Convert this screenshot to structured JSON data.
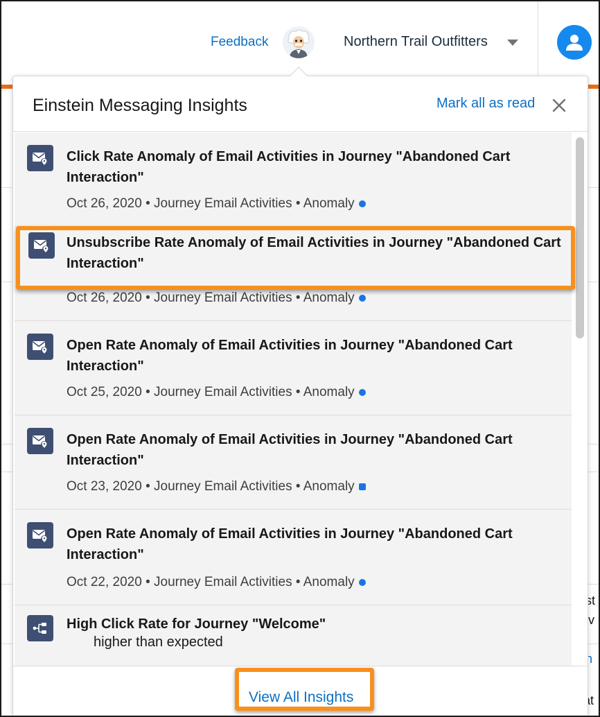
{
  "header": {
    "feedback_label": "Feedback",
    "org_name": "Northern Trail Outfitters"
  },
  "popover": {
    "title": "Einstein Messaging Insights",
    "mark_all_read": "Mark all as read",
    "view_all": "View All Insights",
    "items": [
      {
        "title": "Click Rate Anomaly of Email Activities in Journey \"Abandoned Cart Interaction\"",
        "meta": "Oct 26, 2020 • Journey Email Activities • Anomaly",
        "icon": "email-insight-icon",
        "unread": true
      },
      {
        "title": "Unsubscribe Rate Anomaly of Email Activities in Journey \"Abandoned Cart Interaction\"",
        "meta": "Oct 26, 2020 • Journey Email Activities • Anomaly",
        "icon": "email-insight-icon",
        "unread": true
      },
      {
        "title": "Open Rate Anomaly of Email Activities in Journey \"Abandoned Cart Interaction\"",
        "meta": "Oct 25, 2020 • Journey Email Activities • Anomaly",
        "icon": "email-insight-icon",
        "unread": true
      },
      {
        "title": "Open Rate Anomaly of Email Activities in Journey \"Abandoned Cart Interaction\"",
        "meta": "Oct 23, 2020 • Journey Email Activities • Anomaly",
        "icon": "email-insight-icon",
        "unread": true
      },
      {
        "title": "Open Rate Anomaly of Email Activities in Journey \"Abandoned Cart Interaction\"",
        "meta": "Oct 22, 2020 • Journey Email Activities • Anomaly",
        "icon": "email-insight-icon",
        "unread": true
      },
      {
        "title": "High Click Rate for Journey \"Welcome\"",
        "subtitle": "higher than expected",
        "icon": "journey-flow-icon"
      }
    ]
  },
  "background_fragments": {
    "frag_1": "r",
    "frag_2": "st",
    "frag_3": "ov",
    "frag_4": "n",
    "frag_5": "at"
  },
  "colors": {
    "accent": "#0b6fc4",
    "highlight": "#f7901e",
    "brand_bar": "#e86f16",
    "icon_bg": "#3f4f73",
    "unread_dot": "#1b74e4"
  }
}
